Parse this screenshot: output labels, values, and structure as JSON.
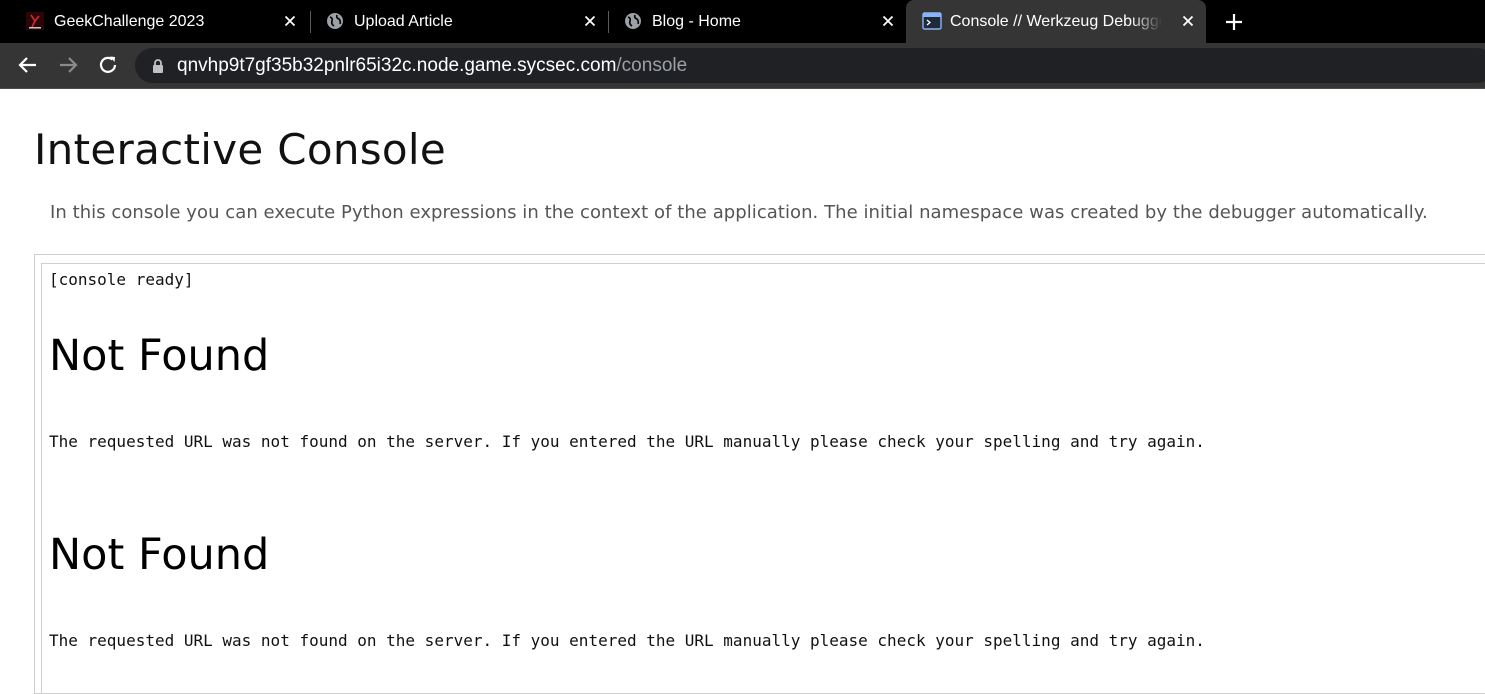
{
  "browser": {
    "tabs": [
      {
        "title": "GeekChallenge 2023",
        "icon": "syclover-favicon-icon",
        "active": false
      },
      {
        "title": "Upload Article",
        "icon": "globe-icon",
        "active": false
      },
      {
        "title": "Blog - Home",
        "icon": "globe-icon",
        "active": false
      },
      {
        "title": "Console // Werkzeug Debugger",
        "icon": "terminal-icon",
        "active": true
      }
    ],
    "address": {
      "host": "qnvhp9t7gf35b32pnlr65i32c.node.game.sycsec.com",
      "path": "/console"
    }
  },
  "page": {
    "title": "Interactive Console",
    "description": "In this console you can execute Python expressions in the context of the application. The initial namespace was created by the debugger automatically.",
    "console": {
      "ready": "[console ready]",
      "outputs": [
        {
          "heading": "Not Found",
          "text": "The requested URL was not found on the server. If you entered the URL manually please check your spelling and try again."
        },
        {
          "heading": "Not Found",
          "text": "The requested URL was not found on the server. If you entered the URL manually please check your spelling and try again."
        }
      ]
    }
  },
  "colors": {
    "tabbar_bg": "#000000",
    "toolbar_bg": "#353535",
    "omnibox_bg": "#202124",
    "url_path": "#9aa0a6"
  }
}
